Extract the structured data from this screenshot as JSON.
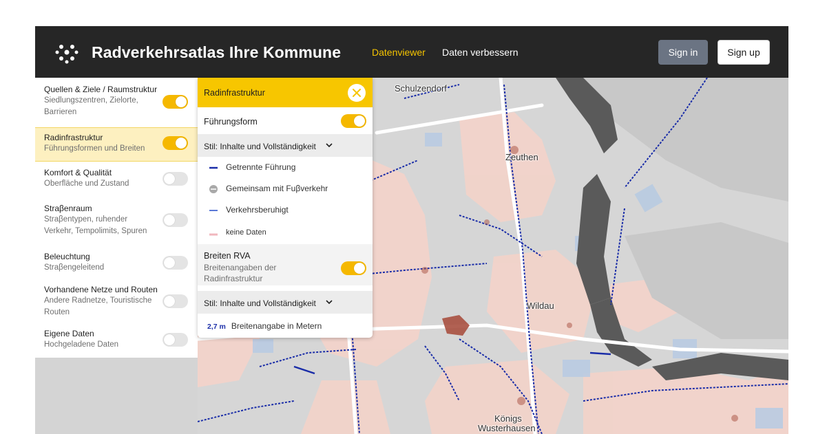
{
  "header": {
    "logo_icon": "dots-logo-icon",
    "brand": "Radverkehrsatlas Ihre Kommune",
    "nav": [
      {
        "label": "Datenviewer",
        "active": true
      },
      {
        "label": "Daten verbessern",
        "active": false
      }
    ],
    "signin_label": "Sign in",
    "signup_label": "Sign up"
  },
  "sidebar": {
    "items": [
      {
        "title": "Quellen & Ziele / Raumstruktur",
        "subtitle": "Siedlungszentren, Zielorte, Barrieren",
        "enabled": true,
        "selected": false
      },
      {
        "title": "Radinfrastruktur",
        "subtitle": "Führungsformen und Breiten",
        "enabled": true,
        "selected": true
      },
      {
        "title": "Komfort & Qualität",
        "subtitle": "Oberfläche und Zustand",
        "enabled": false,
        "selected": false
      },
      {
        "title": "Straβenraum",
        "subtitle": "Straβentypen, ruhender Verkehr, Tempolimits, Spuren",
        "enabled": false,
        "selected": false
      },
      {
        "title": "Beleuchtung",
        "subtitle": "Straβengeleitend",
        "enabled": false,
        "selected": false
      },
      {
        "title": "Vorhandene Netze und Routen",
        "subtitle": "Andere Radnetze, Touristische Routen",
        "enabled": false,
        "selected": false
      },
      {
        "title": "Eigene Daten",
        "subtitle": "Hochgeladene Daten",
        "enabled": false,
        "selected": false
      }
    ]
  },
  "panel": {
    "title": "Radinfrastruktur",
    "close_icon": "close-icon",
    "fuehrungsform": {
      "label": "Führungsform",
      "enabled": true
    },
    "style_label_1": "Stil: Inhalte und Vollständigkeit",
    "legend": [
      {
        "label": "Getrennte Führung",
        "symbol": "solid-dark-blue-line"
      },
      {
        "label": "Gemeinsam mit Fuβverkehr",
        "symbol": "grey-circle"
      },
      {
        "label": "Verkehrsberuhigt",
        "symbol": "light-blue-line"
      },
      {
        "label": "keine Daten",
        "symbol": "pink-line"
      }
    ],
    "breiten": {
      "title": "Breiten RVA",
      "subtitle": "Breitenangaben der Radinfrastruktur",
      "enabled": true
    },
    "style_label_2": "Stil: Inhalte und Vollständigkeit",
    "size_value": "2,7 m",
    "size_label": "Breitenangabe in Metern"
  },
  "map": {
    "labels": [
      {
        "text": "Schulzendorf"
      },
      {
        "text": "Zeuthen"
      },
      {
        "text": "Wildau"
      },
      {
        "text": "Königs"
      },
      {
        "text": "Wusterhausen"
      }
    ]
  },
  "colors": {
    "accent": "#f7c600",
    "header_bg": "#262626",
    "map_water": "#555555",
    "settlement": "#f2d3ca",
    "bike_lane": "#1a2da8"
  }
}
